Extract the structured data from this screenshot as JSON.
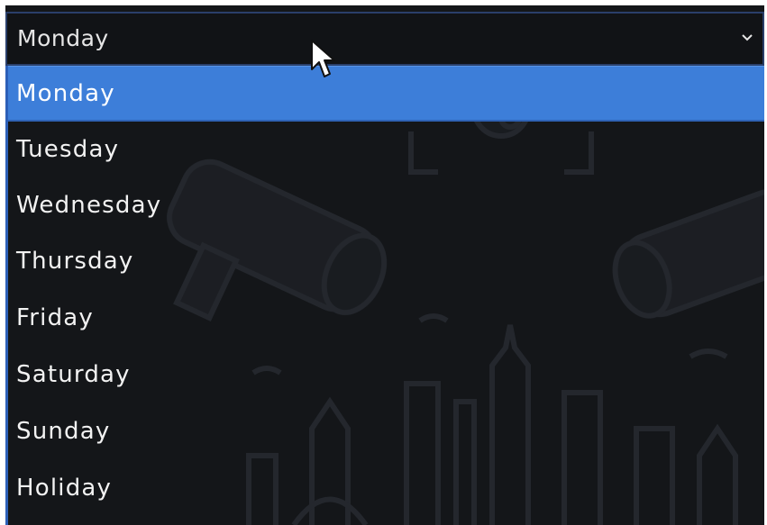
{
  "select": {
    "current_value": "Monday",
    "arrow_icon": "chevron-down-icon"
  },
  "dropdown": {
    "selected_index": 0,
    "options": [
      {
        "label": "Monday"
      },
      {
        "label": "Tuesday"
      },
      {
        "label": "Wednesday"
      },
      {
        "label": "Thursday"
      },
      {
        "label": "Friday"
      },
      {
        "label": "Saturday"
      },
      {
        "label": "Sunday"
      },
      {
        "label": "Holiday"
      }
    ]
  },
  "theme": {
    "background": "#141619",
    "highlight": "#3d7ed9",
    "text": "#f2f2f2",
    "border": "#2c5fb8"
  },
  "cursor_icon": "mouse-pointer-icon"
}
